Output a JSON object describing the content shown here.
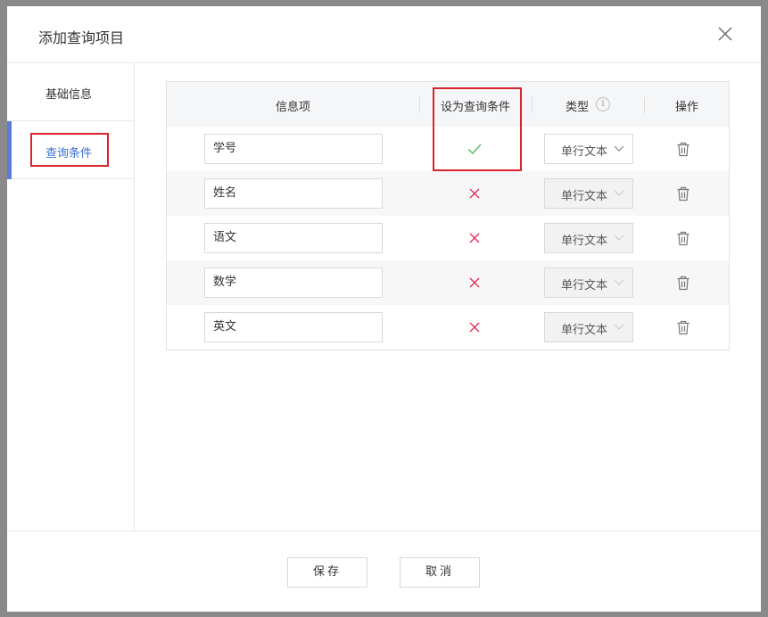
{
  "dialog": {
    "title": "添加查询项目"
  },
  "sidebar": {
    "items": [
      {
        "label": "基础信息",
        "active": false
      },
      {
        "label": "查询条件",
        "active": true
      }
    ]
  },
  "table": {
    "headers": {
      "name": "信息项",
      "is_query": "设为查询条件",
      "type": "类型",
      "type_info_icon": "i",
      "action": "操作"
    },
    "rows": [
      {
        "name": "学号",
        "is_query": true,
        "type": "单行文本",
        "type_enabled": true
      },
      {
        "name": "姓名",
        "is_query": false,
        "type": "单行文本",
        "type_enabled": false
      },
      {
        "name": "语文",
        "is_query": false,
        "type": "单行文本",
        "type_enabled": false
      },
      {
        "name": "数学",
        "is_query": false,
        "type": "单行文本",
        "type_enabled": false
      },
      {
        "name": "英文",
        "is_query": false,
        "type": "单行文本",
        "type_enabled": false
      }
    ]
  },
  "footer": {
    "save_label": "保存",
    "cancel_label": "取消"
  },
  "icons": {
    "close": "close-icon",
    "check": "check-icon",
    "cross": "cross-icon",
    "chevron": "chevron-down-icon",
    "delete": "trash-icon",
    "info": "info-icon"
  },
  "colors": {
    "accent": "#3a6fd3",
    "active_bar": "#5a7dd6",
    "highlight_border": "#d9232d",
    "check": "#5cb85c",
    "cross": "#e0305a"
  }
}
